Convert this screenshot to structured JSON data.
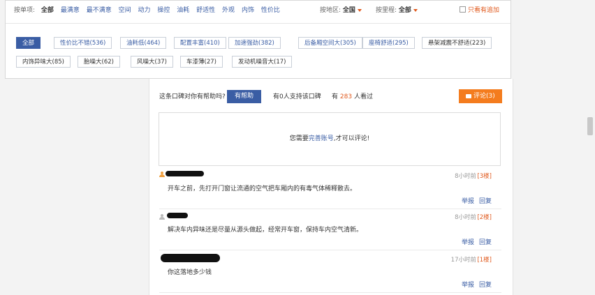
{
  "filters": {
    "item_label": "按单项:",
    "options": [
      "全部",
      "最满意",
      "最不满意",
      "空间",
      "动力",
      "操控",
      "油耗",
      "舒适性",
      "外观",
      "内饰",
      "性价比"
    ],
    "region_label": "按地区:",
    "region_value": "全国",
    "mileage_label": "按里程:",
    "mileage_value": "全部",
    "only_added": "只看有追加"
  },
  "tags": [
    {
      "label": "全部"
    },
    {
      "label": "性价比不错(536)"
    },
    {
      "label": "油耗低(464)"
    },
    {
      "label": "配置丰富(410)"
    },
    {
      "label": "加速强劲(382)"
    },
    {
      "label": "后备厢空间大(305)"
    },
    {
      "label": "座椅舒适(295)"
    },
    {
      "label": "悬架减震不舒适(223)"
    },
    {
      "label": "内饰异味大(85)"
    },
    {
      "label": "胎噪大(62)"
    },
    {
      "label": "风噪大(37)"
    },
    {
      "label": "车漆薄(27)"
    },
    {
      "label": "发动机噪音大(17)"
    }
  ],
  "helpful": {
    "question": "这条口碑对你有帮助吗?",
    "button": "有帮助",
    "support": "有0人支持该口碑",
    "viewed_prefix": "有",
    "viewed_count": "283",
    "viewed_suffix": "人看过",
    "comment_button": "评论(3)"
  },
  "login_prompt": {
    "prefix": "您需要",
    "link": "完善账号",
    "suffix": ",才可以评论!"
  },
  "comments": [
    {
      "time": "8小时前",
      "floor": "[3楼]",
      "text": "开车之前，先打开门窗让流通的空气把车厢内的有毒气体稀释散去。",
      "report": "举报",
      "reply": "回复"
    },
    {
      "time": "8小时前",
      "floor": "[2楼]",
      "text": "解决车内异味还是尽量从源头做起，经常开车窗，保持车内空气清新。",
      "report": "举报",
      "reply": "回复"
    },
    {
      "time": "17小时前",
      "floor": "[1楼]",
      "text": "你这落地多少钱",
      "report": "举报",
      "reply": "回复"
    }
  ],
  "colors": {
    "accent_blue": "#3a5da4",
    "accent_orange": "#f47c1e",
    "highlight": "#e05a1e"
  }
}
